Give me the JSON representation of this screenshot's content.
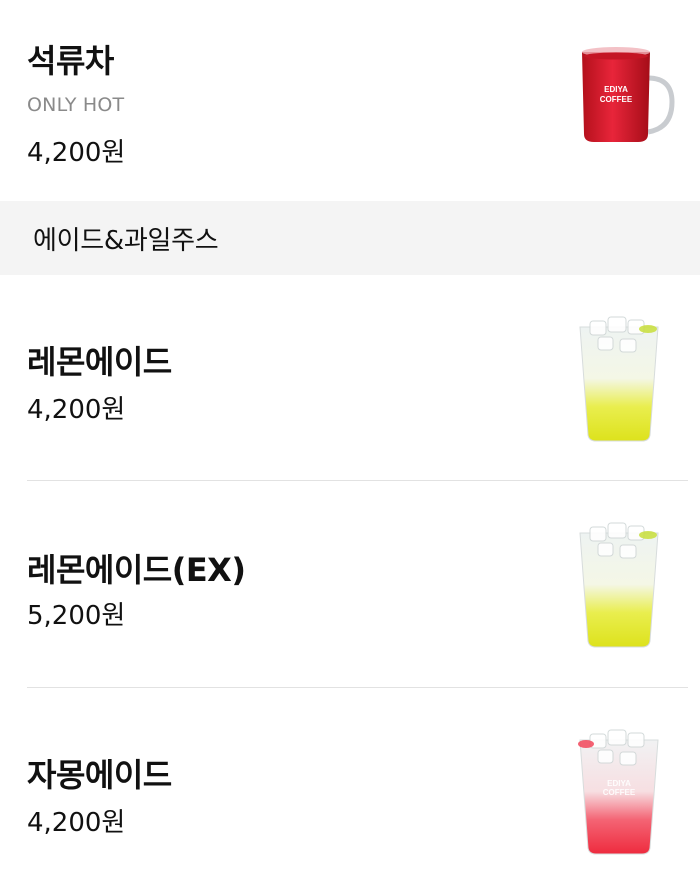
{
  "items_top": {
    "name": "석류차",
    "sub": "ONLY HOT",
    "price": "4,200원",
    "image": "red-tea-mug-image"
  },
  "category": {
    "label": "에이드&과일주스"
  },
  "items": [
    {
      "name": "레몬에이드",
      "price": "4,200원",
      "image": "lemonade-cup-image"
    },
    {
      "name": "레몬에이드(EX)",
      "price": "5,200원",
      "image": "lemonade-ex-cup-image"
    },
    {
      "name": "자몽에이드",
      "price": "4,200원",
      "image": "grapefruit-ade-cup-image"
    }
  ],
  "mug_text": [
    "EDIYA",
    "COFFEE"
  ],
  "colors": {
    "divider": "#e2e2e2",
    "category_bg": "#f4f4f4",
    "text": "#111111",
    "sub_text": "#8a8a8a"
  }
}
